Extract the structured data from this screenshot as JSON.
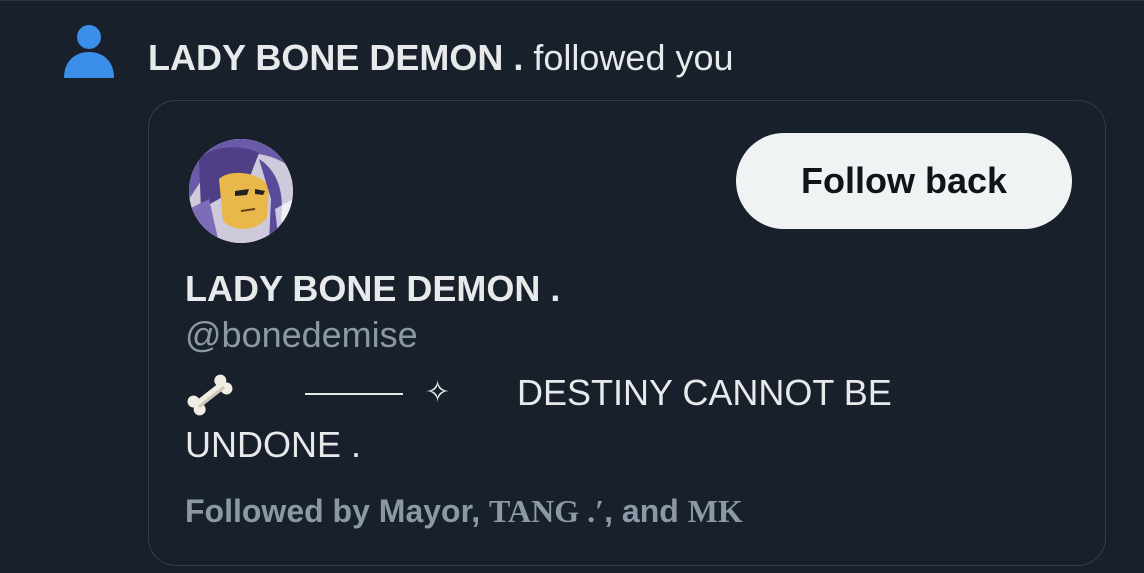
{
  "notification": {
    "icon": "person-icon",
    "actor_name": "LADY BONE DEMON .",
    "action_text": "followed you"
  },
  "card": {
    "follow_button_label": "Follow back",
    "display_name": "LADY BONE DEMON .",
    "handle": "@bonedemise",
    "bio": {
      "emoji": "bone-icon",
      "divider": "———",
      "sparkle": "✧",
      "line1": "DESTINY CANNOT BE",
      "line2": "UNDONE ."
    },
    "followed_by": {
      "prefix": "Followed by ",
      "name1": "Mayor",
      "sep1": ", ",
      "name2": "TANG .′",
      "sep2": ", and ",
      "name3": "MK"
    }
  },
  "colors": {
    "background": "#18202b",
    "icon_blue": "#1d9bf0",
    "text_primary": "#e7e9ea",
    "text_secondary": "#8b98a5",
    "button_bg": "#eff3f4",
    "button_text": "#0f1419"
  }
}
